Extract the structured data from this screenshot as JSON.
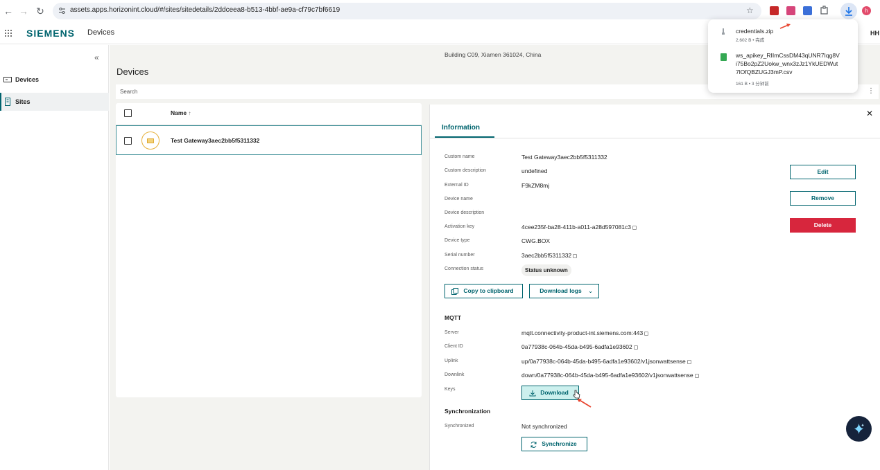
{
  "browser": {
    "url": "assets.apps.horizonint.cloud/#/sites/sitedetails/2ddceea8-b513-4bbf-ae9a-cf79c7bf6619",
    "profile_initial": "h"
  },
  "header": {
    "brand": "SIEMENS",
    "app_title": "Devices",
    "user_initials": "HH"
  },
  "sidebar": {
    "items": [
      {
        "label": "Devices"
      },
      {
        "label": "Sites"
      }
    ]
  },
  "site": {
    "address": "Building C09, Xiamen 361024, China"
  },
  "page": {
    "title": "Devices",
    "search_placeholder": "Search"
  },
  "list": {
    "column_name": "Name",
    "sort_glyph": "↑",
    "rows": [
      {
        "name": "Test Gateway3aec2bb5f5311332"
      }
    ]
  },
  "detail": {
    "tab": "Information",
    "fields": [
      {
        "label": "Custom name",
        "value": "Test Gateway3aec2bb5f5311332"
      },
      {
        "label": "Custom description",
        "value": "undefined"
      },
      {
        "label": "External ID",
        "value": "F9kZM8mj"
      },
      {
        "label": "Device name",
        "value": ""
      },
      {
        "label": "Device description",
        "value": ""
      },
      {
        "label": "Activation key",
        "value": "4cee235f-ba28-411b-a011-a28d597081c3"
      },
      {
        "label": "Device type",
        "value": "CWG.BOX"
      },
      {
        "label": "Serial number",
        "value": "3aec2bb5f5311332"
      },
      {
        "label": "Connection status",
        "value": "Status unknown"
      }
    ],
    "buttons": {
      "edit": "Edit",
      "remove": "Remove",
      "delete": "Delete",
      "copy": "Copy to clipboard",
      "download_logs": "Download logs"
    },
    "mqtt": {
      "title": "MQTT",
      "fields": [
        {
          "label": "Server",
          "value": "mqtt.connectivity-product-int.siemens.com:443"
        },
        {
          "label": "Client ID",
          "value": "0a77938c-064b-45da-b495-6adfa1e93602"
        },
        {
          "label": "Uplink",
          "value": "up/0a77938c-064b-45da-b495-6adfa1e93602/v1jsonwattsense"
        },
        {
          "label": "Downlink",
          "value": "down/0a77938c-064b-45da-b495-6adfa1e93602/v1jsonwattsense"
        }
      ],
      "keys_label": "Keys",
      "download": "Download"
    },
    "sync": {
      "title": "Synchronization",
      "label": "Synchronized",
      "value": "Not synchronized",
      "button": "Synchronize"
    }
  },
  "downloads": [
    {
      "name": "credentials.zip",
      "meta": "2,602 B • 完成"
    },
    {
      "name": "ws_apikey_RIImCssDM43qUNR7Iqg8Vi75Bo2pZ2Uokw_wnx3zJz1YkUEDWut7lOfQBZUGJ3mP.csv",
      "meta": "161 B • 3 分钟前"
    }
  ],
  "colors": {
    "brand": "#00646e",
    "danger": "#d7263d",
    "download_bg": "#ccf0ee"
  }
}
